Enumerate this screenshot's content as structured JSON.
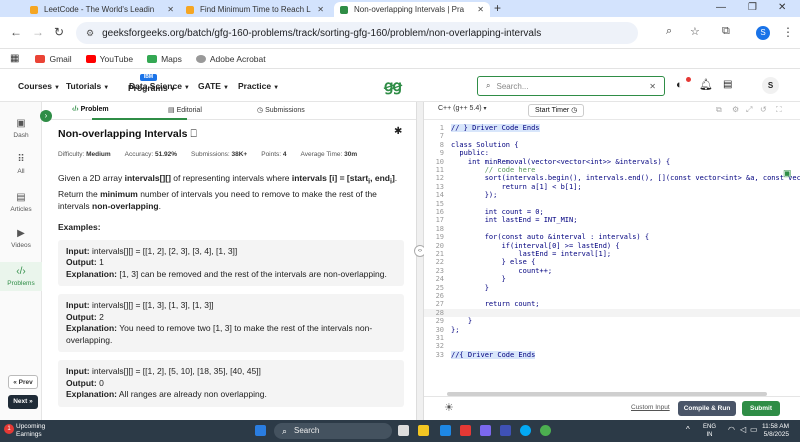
{
  "browser": {
    "tabs": [
      {
        "title": "LeetCode - The World's Leadin",
        "active": false
      },
      {
        "title": "Find Minimum Time to Reach La",
        "active": false
      },
      {
        "title": "Non-overlapping Intervals | Pra",
        "active": true
      }
    ],
    "url": "geeksforgeeks.org/batch/gfg-160-problems/track/sorting-gfg-160/problem/non-overlapping-intervals",
    "profile_initial": "S",
    "bookmarks": [
      "Gmail",
      "YouTube",
      "Maps",
      "Adobe Acrobat"
    ]
  },
  "header": {
    "menu": [
      "Courses",
      "Tutorials",
      "Programs",
      "Data Science",
      "GATE",
      "Practice"
    ],
    "data_science_badge": "IBM",
    "search_placeholder": "Search...",
    "avatar_initial": "S"
  },
  "sidebar": {
    "items": [
      "Dash",
      "All",
      "Articles",
      "Videos",
      "Problems"
    ],
    "prev": "« Prev",
    "next": "Next »"
  },
  "problem_tabs": [
    "Problem",
    "Editorial",
    "Submissions"
  ],
  "problem": {
    "title": "Non-overlapping Intervals",
    "difficulty_label": "Difficulty:",
    "difficulty": "Medium",
    "accuracy_label": "Accuracy:",
    "accuracy": "51.92%",
    "submissions_label": "Submissions:",
    "submissions": "38K+",
    "points_label": "Points:",
    "points": "4",
    "time_label": "Average Time:",
    "time": "30m",
    "desc_1": "Given a 2D array ",
    "desc_2": "intervals[][]",
    "desc_3": " of representing intervals where ",
    "desc_4": "intervals [i] = [start",
    "desc_4b": "i",
    "desc_4c": ", end",
    "desc_4d": "i",
    "desc_4e": "]",
    "desc_5": ". Return the ",
    "desc_6": "minimum",
    "desc_7": " number of intervals you need to remove to make the rest of the intervals ",
    "desc_8": "non-overlapping",
    "desc_9": ".",
    "examples_heading": "Examples:",
    "examples": [
      {
        "input": "intervals[][] = [[1, 2], [2, 3], [3, 4], [1, 3]]",
        "output": "1",
        "explanation": "[1, 3] can be removed and the rest of the intervals are non-overlapping."
      },
      {
        "input": "intervals[][] = [[1, 3], [1, 3], [1, 3]]",
        "output": "2",
        "explanation": "You need to remove two [1, 3] to make the rest of the intervals non-overlapping."
      },
      {
        "input": "intervals[][] = [[1, 2], [5, 10], [18, 35], [40, 45]]",
        "output": "0",
        "explanation": "All ranges are already non overlapping."
      }
    ],
    "input_label": "Input:",
    "output_label": "Output:",
    "explanation_label": "Explanation:"
  },
  "editor": {
    "language": "C++ (g++ 5.4)",
    "timer": "Start Timer",
    "lines": [
      {
        "n": "1",
        "t": "// } Driver Code Ends",
        "hl": true
      },
      {
        "n": "7",
        "t": "",
        "hl": false
      },
      {
        "n": "8",
        "t": "class Solution {",
        "hl": false
      },
      {
        "n": "9",
        "t": "  public:",
        "hl": false
      },
      {
        "n": "10",
        "t": "    int minRemoval(vector<vector<int>> &intervals) {",
        "hl": false
      },
      {
        "n": "11",
        "t": "        // code here",
        "hl": false
      },
      {
        "n": "12",
        "t": "        sort(intervals.begin(), intervals.end(), [](const vector<int> &a, const vector<i",
        "hl": false
      },
      {
        "n": "13",
        "t": "            return a[1] < b[1];",
        "hl": false
      },
      {
        "n": "14",
        "t": "        });",
        "hl": false
      },
      {
        "n": "15",
        "t": "",
        "hl": false
      },
      {
        "n": "16",
        "t": "        int count = 0;",
        "hl": false
      },
      {
        "n": "17",
        "t": "        int lastEnd = INT_MIN;",
        "hl": false
      },
      {
        "n": "18",
        "t": "",
        "hl": false
      },
      {
        "n": "19",
        "t": "        for(const auto &interval : intervals) {",
        "hl": false
      },
      {
        "n": "20",
        "t": "            if(interval[0] >= lastEnd) {",
        "hl": false
      },
      {
        "n": "21",
        "t": "                lastEnd = interval[1];",
        "hl": false
      },
      {
        "n": "22",
        "t": "            } else {",
        "hl": false
      },
      {
        "n": "23",
        "t": "                count++;",
        "hl": false
      },
      {
        "n": "24",
        "t": "            }",
        "hl": false
      },
      {
        "n": "25",
        "t": "        }",
        "hl": false
      },
      {
        "n": "26",
        "t": "",
        "hl": false
      },
      {
        "n": "27",
        "t": "        return count;",
        "hl": false
      },
      {
        "n": "28",
        "t": "",
        "hl": false
      },
      {
        "n": "29",
        "t": "    }",
        "hl": false
      },
      {
        "n": "30",
        "t": "};",
        "hl": false
      },
      {
        "n": "31",
        "t": "",
        "hl": false
      },
      {
        "n": "32",
        "t": "",
        "hl": false
      },
      {
        "n": "33",
        "t": "//{ Driver Code Ends",
        "hl": true
      }
    ],
    "custom_input": "Custom Input",
    "compile": "Compile & Run",
    "submit": "Submit"
  },
  "taskbar": {
    "weather_title": "Upcoming",
    "weather_sub": "Earnings",
    "badge": "1",
    "search": "Search",
    "lang": "ENG",
    "region": "IN",
    "time": "11:58 AM",
    "date": "5/8/2025"
  },
  "colors": {
    "brand": "#2f8d46",
    "tabstrip": "#d3e3fd",
    "taskbar": "#2c3a47"
  }
}
